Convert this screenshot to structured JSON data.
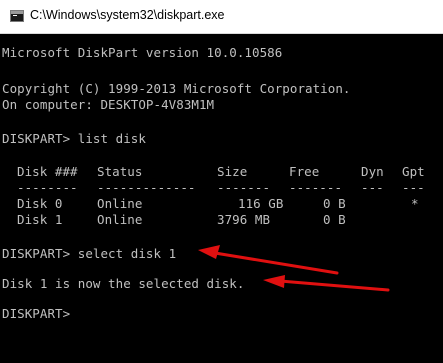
{
  "window": {
    "title": "C:\\Windows\\system32\\diskpart.exe"
  },
  "console": {
    "version_line": "Microsoft DiskPart version 10.0.10586",
    "copyright_line": "Copyright (C) 1999-2013 Microsoft Corporation.",
    "computer_line": "On computer: DESKTOP-4V83M1M",
    "command1": "DISKPART> list disk",
    "table": {
      "headers": [
        "Disk ###",
        "Status",
        "Size",
        "Free",
        "Dyn",
        "Gpt"
      ],
      "separators": [
        "--------",
        "-------------",
        "-------",
        "-------",
        "---",
        "---"
      ],
      "rows": [
        [
          "Disk 0",
          "Online",
          "116 GB",
          "0 B",
          "",
          "*"
        ],
        [
          "Disk 1",
          "Online",
          "3796 MB",
          "0 B",
          "",
          ""
        ]
      ]
    },
    "command2": "DISKPART> select disk 1",
    "result": "Disk 1 is now the selected disk.",
    "prompt": "DISKPART>"
  },
  "colors": {
    "console_text": "#c0c0c0",
    "console_bg": "#000000",
    "arrow": "#e01010"
  }
}
